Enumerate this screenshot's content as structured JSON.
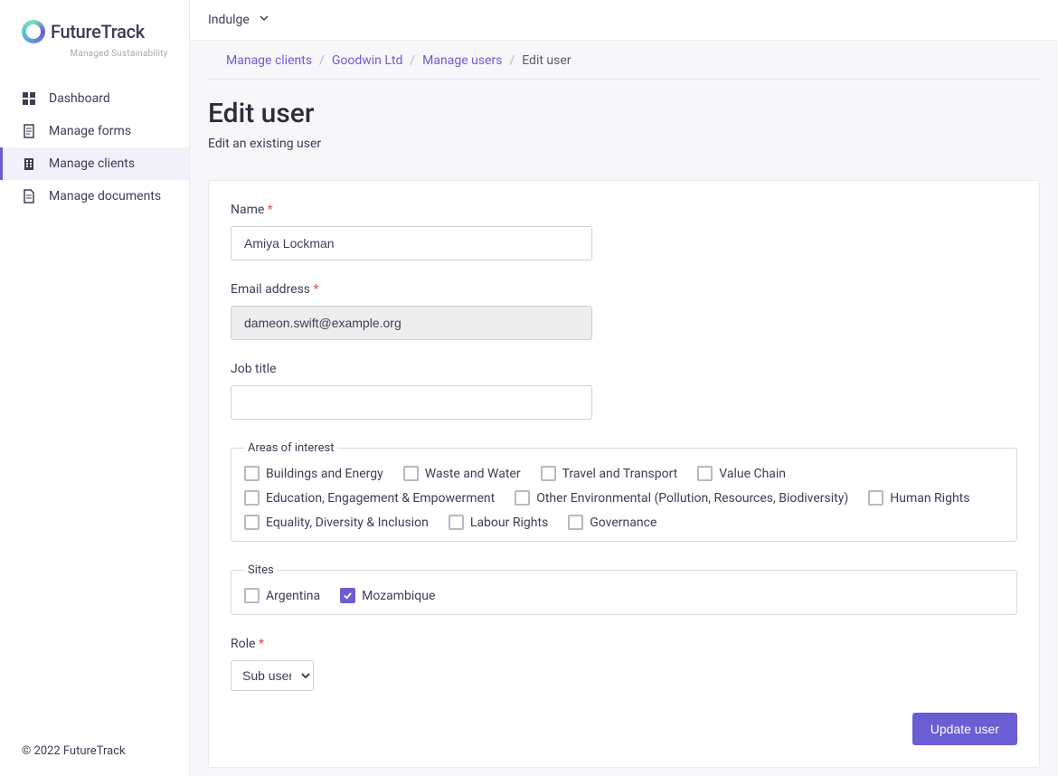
{
  "brand": {
    "title": "FutureTrack",
    "subtitle": "Managed Sustainability"
  },
  "sidebar": {
    "items": [
      {
        "id": "dashboard",
        "label": "Dashboard",
        "icon": "dashboard",
        "active": false
      },
      {
        "id": "manage-forms",
        "label": "Manage forms",
        "icon": "forms",
        "active": false
      },
      {
        "id": "manage-clients",
        "label": "Manage clients",
        "icon": "clients",
        "active": true
      },
      {
        "id": "manage-documents",
        "label": "Manage documents",
        "icon": "documents",
        "active": false
      }
    ],
    "footer": "© 2022 FutureTrack"
  },
  "topbar": {
    "org": "Indulge"
  },
  "breadcrumb": {
    "items": [
      {
        "label": "Manage clients",
        "link": true
      },
      {
        "label": "Goodwin Ltd",
        "link": true
      },
      {
        "label": "Manage users",
        "link": true
      },
      {
        "label": "Edit user",
        "link": false
      }
    ]
  },
  "page": {
    "title": "Edit user",
    "subtitle": "Edit an existing user"
  },
  "form": {
    "name": {
      "label": "Name",
      "required": true,
      "value": "Amiya Lockman"
    },
    "email": {
      "label": "Email address",
      "required": true,
      "value": "dameon.swift@example.org",
      "disabled": true
    },
    "job_title": {
      "label": "Job title",
      "required": false,
      "value": ""
    },
    "areas_of_interest": {
      "legend": "Areas of interest",
      "options": [
        {
          "id": "buildings-energy",
          "label": "Buildings and Energy",
          "checked": false
        },
        {
          "id": "waste-water",
          "label": "Waste and Water",
          "checked": false
        },
        {
          "id": "travel-transport",
          "label": "Travel and Transport",
          "checked": false
        },
        {
          "id": "value-chain",
          "label": "Value Chain",
          "checked": false
        },
        {
          "id": "education",
          "label": "Education, Engagement & Empowerment",
          "checked": false
        },
        {
          "id": "other-environmental",
          "label": "Other Environmental (Pollution, Resources, Biodiversity)",
          "checked": false
        },
        {
          "id": "human-rights",
          "label": "Human Rights",
          "checked": false
        },
        {
          "id": "equality",
          "label": "Equality, Diversity & Inclusion",
          "checked": false
        },
        {
          "id": "labour-rights",
          "label": "Labour Rights",
          "checked": false
        },
        {
          "id": "governance",
          "label": "Governance",
          "checked": false
        }
      ]
    },
    "sites": {
      "legend": "Sites",
      "options": [
        {
          "id": "argentina",
          "label": "Argentina",
          "checked": false
        },
        {
          "id": "mozambique",
          "label": "Mozambique",
          "checked": true
        }
      ]
    },
    "role": {
      "label": "Role",
      "required": true,
      "value": "Sub user"
    },
    "submit_label": "Update user"
  }
}
